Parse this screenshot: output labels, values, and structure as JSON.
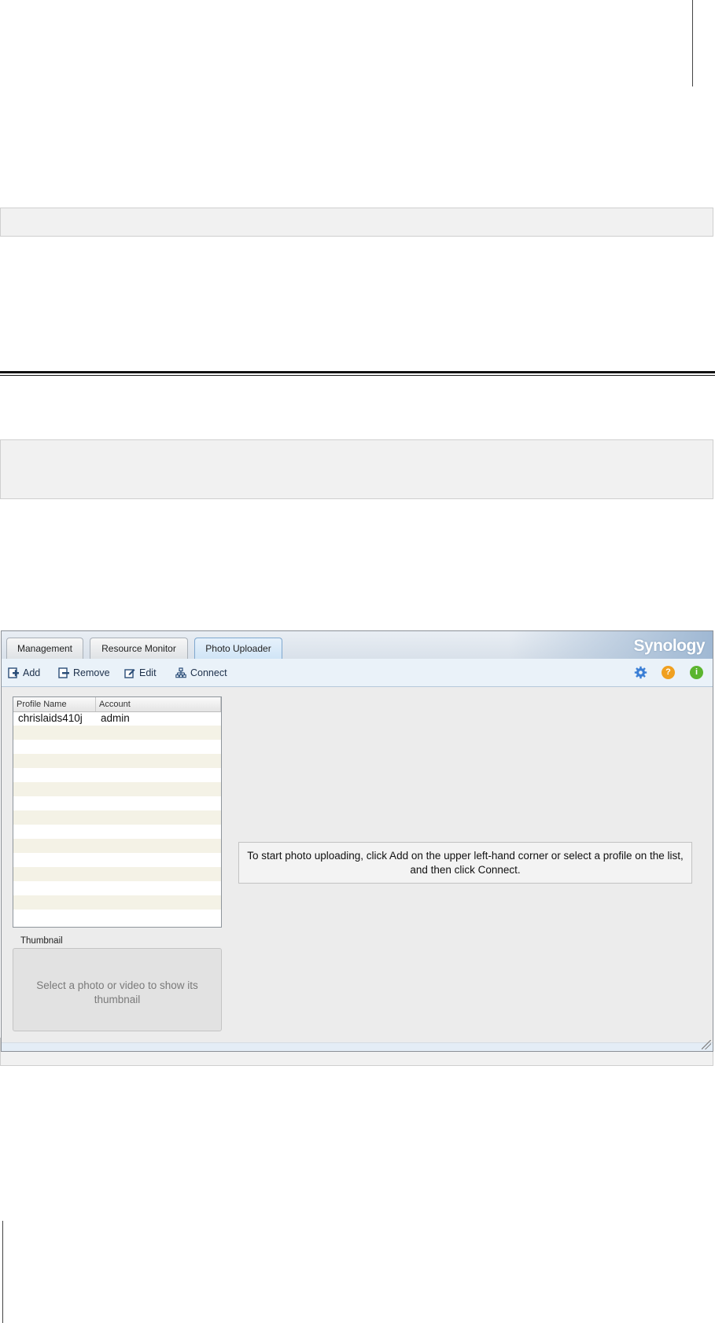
{
  "window": {
    "brand": "Synology",
    "tabs": [
      {
        "label": "Management"
      },
      {
        "label": "Resource Monitor"
      },
      {
        "label": "Photo Uploader"
      }
    ],
    "active_tab": "Photo Uploader"
  },
  "toolbar": {
    "add_label": "Add",
    "remove_label": "Remove",
    "edit_label": "Edit",
    "connect_label": "Connect",
    "right_icons": [
      "settings-gear-icon",
      "help-icon",
      "info-icon"
    ]
  },
  "profile_list": {
    "columns": [
      "Profile Name",
      "Account"
    ],
    "rows": [
      {
        "profile_name": "chrislaids410j",
        "account": "admin"
      }
    ]
  },
  "thumbnail": {
    "label": "Thumbnail",
    "placeholder": "Select a photo or video to show its thumbnail"
  },
  "message": "To start photo uploading, click Add on the upper left-hand corner or select a profile on the list, and then click Connect.",
  "colors": {
    "active_tab": "#cfe4f6",
    "toolbar_bg": "#eaf2f9",
    "list_stripe": "#f4f2e6",
    "help_icon": "#f0a020",
    "info_icon": "#5bb52f",
    "gear_icon": "#3b7fd6"
  }
}
